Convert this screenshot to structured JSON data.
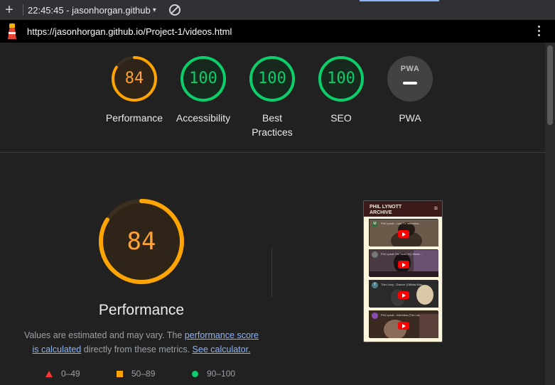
{
  "toolbar": {
    "plus_icon": "plus-icon",
    "report_label": "22:45:45 - jasonhorgan.github",
    "caret": "▾",
    "block_icon": "block-icon"
  },
  "urlbar": {
    "url": "https://jasonhorgan.github.io/Project-1/videos.html",
    "logo_icon": "lighthouse-icon",
    "menu_icon": "kebab-menu-icon"
  },
  "colors": {
    "average": "#ffa400",
    "pass": "#0cce6b",
    "fail": "#ff3333",
    "link": "#8ab4f8",
    "pwa_gray": "#424242"
  },
  "gauges": [
    {
      "score": "84",
      "value": 84,
      "status": "average",
      "label": "Performance"
    },
    {
      "score": "100",
      "value": 100,
      "status": "pass",
      "label": "Accessibility"
    },
    {
      "score": "100",
      "value": 100,
      "status": "pass",
      "label_line1": "Best",
      "label_line2": "Practices"
    },
    {
      "score": "100",
      "value": 100,
      "status": "pass",
      "label": "SEO"
    },
    {
      "pwa_badge": "PWA",
      "label": "PWA"
    }
  ],
  "performance": {
    "score": "84",
    "value": 84,
    "title": "Performance",
    "desc_prefix": "Values are estimated and may vary. The ",
    "link_score": "performance score",
    "link_calc": "is calculated",
    "desc_mid": " directly from these metrics. ",
    "link_calculator": "See calculator."
  },
  "legend": {
    "fail": "0–49",
    "average": "50–89",
    "pass": "90–100"
  },
  "screenshot": {
    "title_line1": "PHIL LYNOTT",
    "title_line2": "ARCHIVE",
    "menu_icon": "≡",
    "videos": [
      {
        "avatar": "M",
        "caption": "Phil Lynott - Last TV Interview..."
      },
      {
        "avatar": "",
        "caption": "Phil Lynott Old Town HQ Music..."
      },
      {
        "avatar": "T",
        "caption": "Thin Lizzy - Dancin' (Official Mus..."
      },
      {
        "avatar": "",
        "caption": "Phil Lynott - Interview (The Lat..."
      }
    ]
  }
}
